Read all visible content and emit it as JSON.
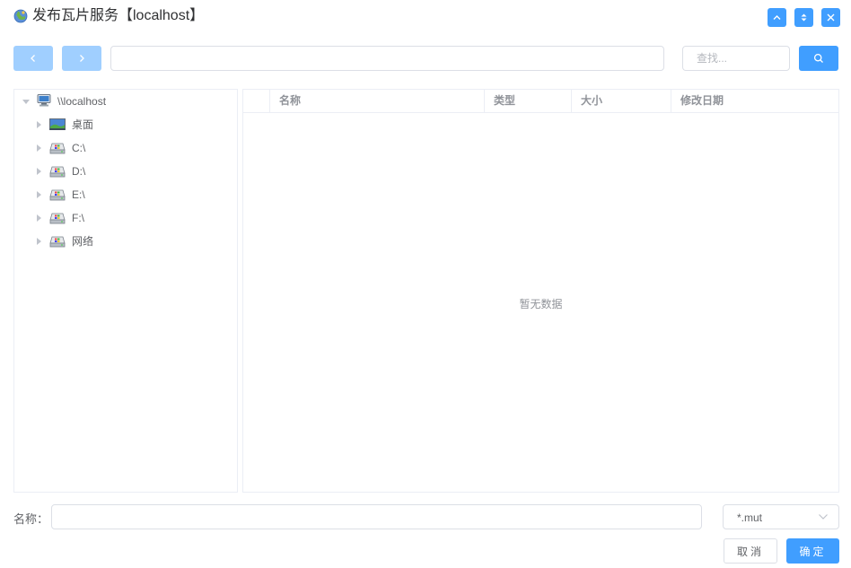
{
  "window": {
    "title": "发布瓦片服务【localhost】",
    "accent_color": "#409eff",
    "buttons": [
      {
        "name": "collapse-window-button",
        "icon": "chevron-up-icon"
      },
      {
        "name": "maximize-window-button",
        "icon": "double-chevron-icon"
      },
      {
        "name": "close-window-button",
        "icon": "close-icon"
      }
    ]
  },
  "toolbar": {
    "back_icon": "chevron-left-icon",
    "forward_icon": "chevron-right-icon",
    "path_value": "",
    "search_placeholder": "查找...",
    "search_icon": "search-icon"
  },
  "tree": {
    "root": {
      "label": "\\\\localhost",
      "icon": "computer-icon",
      "expanded": true
    },
    "children": [
      {
        "label": "桌面",
        "icon": "desktop-icon"
      },
      {
        "label": "C:\\",
        "icon": "drive-icon"
      },
      {
        "label": "D:\\",
        "icon": "drive-icon"
      },
      {
        "label": "E:\\",
        "icon": "drive-icon"
      },
      {
        "label": "F:\\",
        "icon": "drive-icon"
      },
      {
        "label": "网络",
        "icon": "drive-icon"
      }
    ]
  },
  "table": {
    "columns": [
      "名称",
      "类型",
      "大小",
      "修改日期"
    ],
    "empty_text": "暂无数据"
  },
  "footer": {
    "name_label": "名称：",
    "name_value": "",
    "filter_value": "*.mut",
    "cancel_label": "取消",
    "ok_label": "确定"
  }
}
